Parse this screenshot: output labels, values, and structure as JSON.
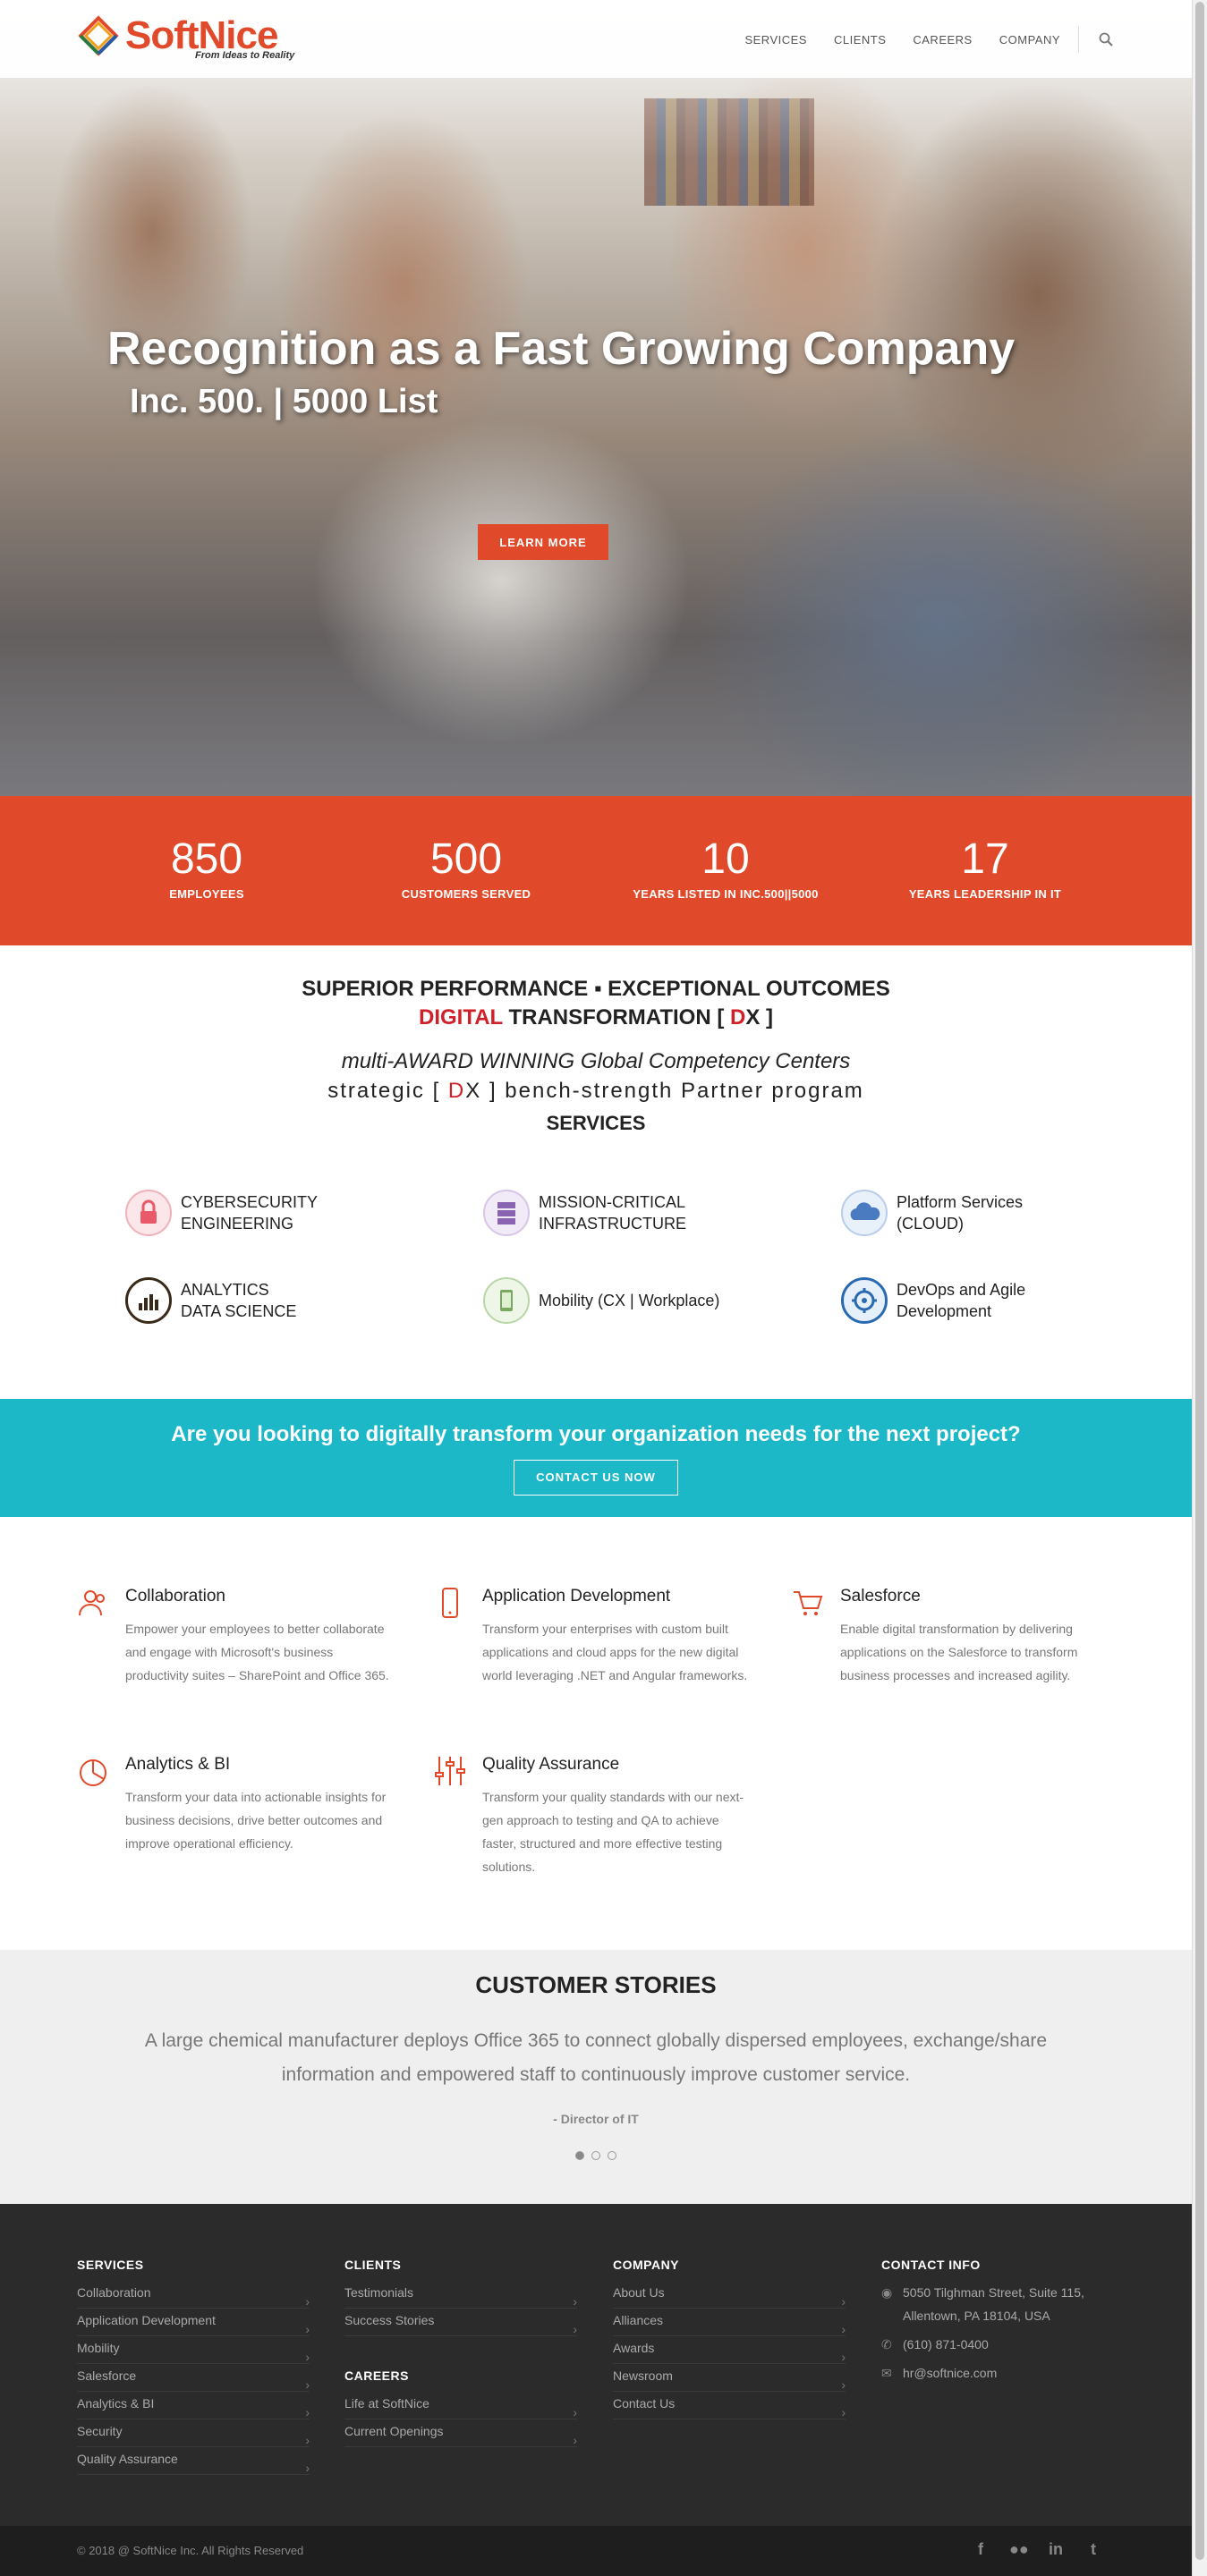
{
  "header": {
    "logo_soft": "Soft",
    "logo_nice": "Nice",
    "logo_tagline": "From Ideas to Reality",
    "nav": [
      "SERVICES",
      "CLIENTS",
      "CAREERS",
      "COMPANY"
    ],
    "search_icon": "search-icon"
  },
  "hero": {
    "title": "Recognition as a Fast Growing Company",
    "subtitle": "Inc. 500. | 5000 List",
    "button": "LEARN MORE"
  },
  "stats": [
    {
      "num": "850",
      "label": "EMPLOYEES"
    },
    {
      "num": "500",
      "label": "CUSTOMERS SERVED"
    },
    {
      "num": "10",
      "label": "YEARS LISTED IN INC.500||5000"
    },
    {
      "num": "17",
      "label": "YEARS LEADERSHIP IN IT"
    }
  ],
  "intro": {
    "line1": "SUPERIOR PERFORMANCE ▪ EXCEPTIONAL OUTCOMES",
    "line2_red": "DIGITAL",
    "line2_rest": " TRANSFORMATION [ ",
    "line2_d": "D",
    "line2_end": "X ]",
    "line3": "multi-AWARD WINNING Global Competency Centers",
    "line4_a": "strategic [ ",
    "line4_d": "D",
    "line4_b": "X ] bench-strength Partner program",
    "line5": "SERVICES"
  },
  "services": [
    {
      "label": "CYBERSECURITY\nENGINEERING",
      "icon": "lock-icon",
      "color": "#e85a6a"
    },
    {
      "label": "MISSION-CRITICAL\nINFRASTRUCTURE",
      "icon": "server-icon",
      "color": "#8a64b0"
    },
    {
      "label": "Platform Services\n(CLOUD)",
      "icon": "cloud-icon",
      "color": "#4a7ac0"
    },
    {
      "label": "ANALYTICS\nDATA SCIENCE",
      "icon": "analytics-icon",
      "color": "#3a2a1a"
    },
    {
      "label": "Mobility (CX | Workplace)",
      "icon": "mobile-icon",
      "color": "#7aa860"
    },
    {
      "label": "DevOps and Agile\nDevelopment",
      "icon": "devops-icon",
      "color": "#2a6ab0"
    }
  ],
  "cta": {
    "question": "Are you looking to digitally transform your organization needs for the next project?",
    "button": "CONTACT US NOW"
  },
  "features": [
    {
      "title": "Collaboration",
      "desc": "Empower your employees to better collaborate and engage with Microsoft's business productivity suites – SharePoint and Office 365.",
      "icon": "users-icon"
    },
    {
      "title": "Application Development",
      "desc": "Transform your enterprises with custom built applications and cloud apps for the new digital world leveraging .NET and Angular frameworks.",
      "icon": "smartphone-icon"
    },
    {
      "title": "Salesforce",
      "desc": "Enable digital transformation by delivering applications on the Salesforce to transform business processes and increased agility.",
      "icon": "cart-icon"
    },
    {
      "title": "Analytics & BI",
      "desc": "Transform your data into actionable insights for business decisions, drive better outcomes and improve operational efficiency.",
      "icon": "pie-chart-icon"
    },
    {
      "title": "Quality Assurance",
      "desc": "Transform your quality standards with our next-gen approach to testing and QA to achieve faster, structured and more effective testing solutions.",
      "icon": "sliders-icon"
    }
  ],
  "stories": {
    "title": "CUSTOMER STORIES",
    "quote": "A large chemical manufacturer deploys Office 365 to connect globally dispersed employees, exchange/share information and empowered staff to continuously improve customer service.",
    "author": "- Director of IT"
  },
  "footer": {
    "services_title": "SERVICES",
    "services": [
      "Collaboration",
      "Application Development",
      "Mobility",
      "Salesforce",
      "Analytics & BI",
      "Security",
      "Quality Assurance"
    ],
    "clients_title": "CLIENTS",
    "clients": [
      "Testimonials",
      "Success Stories"
    ],
    "careers_title": "CAREERS",
    "careers": [
      "Life at SoftNice",
      "Current Openings"
    ],
    "company_title": "COMPANY",
    "company": [
      "About Us",
      "Alliances",
      "Awards",
      "Newsroom",
      "Contact Us"
    ],
    "contact_title": "CONTACT INFO",
    "address": "5050 Tilghman Street, Suite 115, Allentown, PA 18104, USA",
    "phone": "(610) 871-0400",
    "email": "hr@softnice.com",
    "copyright": "© 2018 @ SoftNice Inc. All Rights Reserved",
    "social": [
      "facebook-icon",
      "flickr-icon",
      "linkedin-icon",
      "twitter-icon"
    ]
  },
  "colors": {
    "accent": "#e04a2a",
    "cta": "#1db8c8",
    "footer": "#2b2b2b"
  }
}
